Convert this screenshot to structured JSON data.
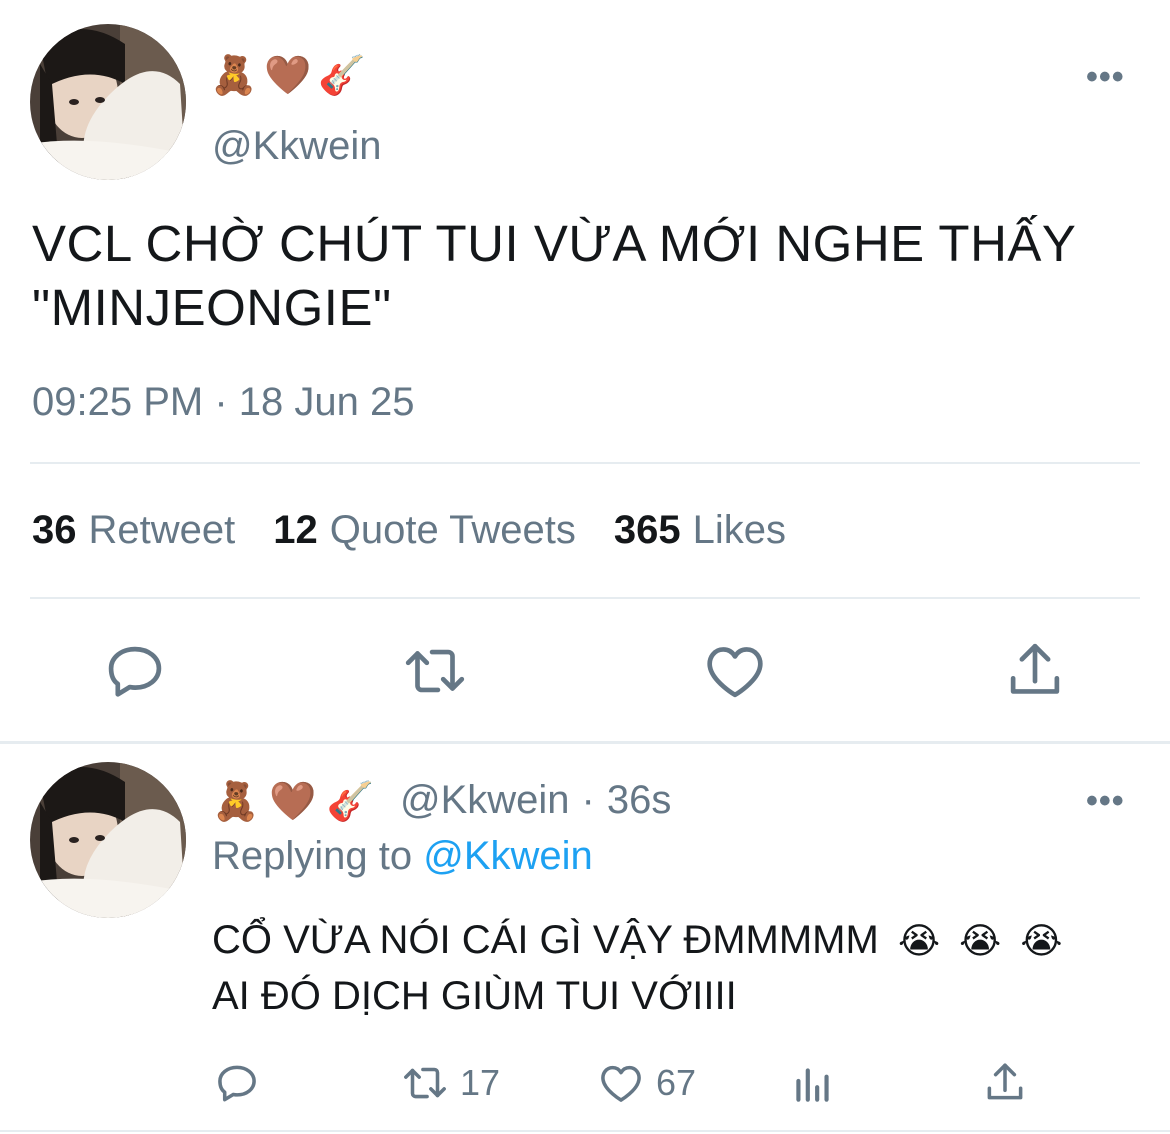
{
  "tweet": {
    "display_name_emojis": [
      "🧸",
      "🤎",
      "🎸"
    ],
    "handle": "@Kkwein",
    "text_line1": "VCL CHỜ CHÚT TUI VỪA MỚI NGHE THẤY",
    "text_line2": "\"MINJEONGIE\"",
    "timestamp": "09:25 PM · 18 Jun 25",
    "stats": {
      "retweet_count": "36",
      "retweet_label": "Retweet",
      "quote_count": "12",
      "quote_label": "Quote Tweets",
      "likes_count": "365",
      "likes_label": "Likes"
    },
    "more_label": "•••"
  },
  "reply": {
    "display_name_emojis": [
      "🧸",
      "🤎",
      "🎸"
    ],
    "handle": "@Kkwein",
    "separator": "·",
    "age": "36s",
    "replying_prefix": "Replying to",
    "replying_to": "@Kkwein",
    "text_line1": "CỔ VỪA NÓI CÁI GÌ VẬY ĐMMMMM",
    "text_emojis": [
      "😭",
      "😭",
      "😭"
    ],
    "text_line2": "AI ĐÓ DỊCH GIÙM TUI VỚIIII",
    "retweet_count": "17",
    "like_count": "67",
    "more_label": "•••"
  },
  "colors": {
    "text": "#14171a",
    "secondary": "#657786",
    "accent": "#1da1f2",
    "divider": "#e6ecf0"
  },
  "icons": {
    "main_actions": [
      "reply-icon",
      "retweet-icon",
      "like-icon",
      "share-icon"
    ],
    "reply_actions": [
      "reply-icon",
      "retweet-icon",
      "like-icon",
      "analytics-icon",
      "share-icon"
    ]
  }
}
